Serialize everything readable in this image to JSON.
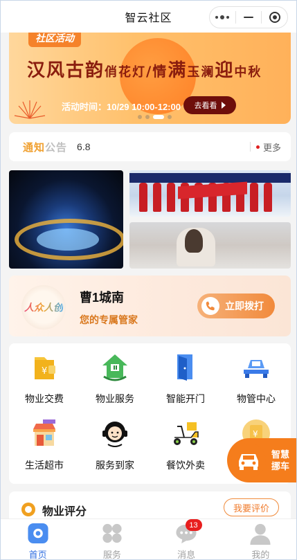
{
  "window": {
    "title": "智云社区"
  },
  "banner": {
    "tag": "社区活动",
    "headline_a": "汉风古韵",
    "headline_b": "俏花灯",
    "headline_c": "/情",
    "headline_d": "满",
    "headline_e": "玉澜",
    "headline_f": "迎",
    "headline_g": "中秋",
    "time": "活动时间：10/29 10:00-12:00",
    "button": "去看看",
    "active_slide": 3,
    "total_slides": 4
  },
  "notice": {
    "label_a": "通知",
    "label_b": "公告",
    "text": "6.8",
    "more": "更多"
  },
  "butler": {
    "avatar_text": "人众人创",
    "name": "曹1城南",
    "subtitle": "您的专属管家",
    "call_button": "立即拨打"
  },
  "services": [
    {
      "label": "物业交费",
      "icon": "payment-icon"
    },
    {
      "label": "物业服务",
      "icon": "house-service-icon"
    },
    {
      "label": "智能开门",
      "icon": "door-icon"
    },
    {
      "label": "物管中心",
      "icon": "car-center-icon"
    },
    {
      "label": "生活超市",
      "icon": "supermarket-icon"
    },
    {
      "label": "服务到家",
      "icon": "home-service-icon"
    },
    {
      "label": "餐饮外卖",
      "icon": "delivery-scooter-icon"
    },
    {
      "label": "",
      "icon": "yuan-coin-icon"
    }
  ],
  "float_button": {
    "line1": "智慧",
    "line2": "挪车"
  },
  "rating": {
    "title": "物业评分",
    "button": "我要评价"
  },
  "tabbar": {
    "tabs": [
      {
        "label": "首页",
        "active": true
      },
      {
        "label": "服务",
        "active": false
      },
      {
        "label": "消息",
        "active": false,
        "badge": "13"
      },
      {
        "label": "我的",
        "active": false
      }
    ]
  },
  "colors": {
    "accent": "#f57d1c",
    "active_tab": "#2f6ee0",
    "badge": "#e81e1e"
  }
}
